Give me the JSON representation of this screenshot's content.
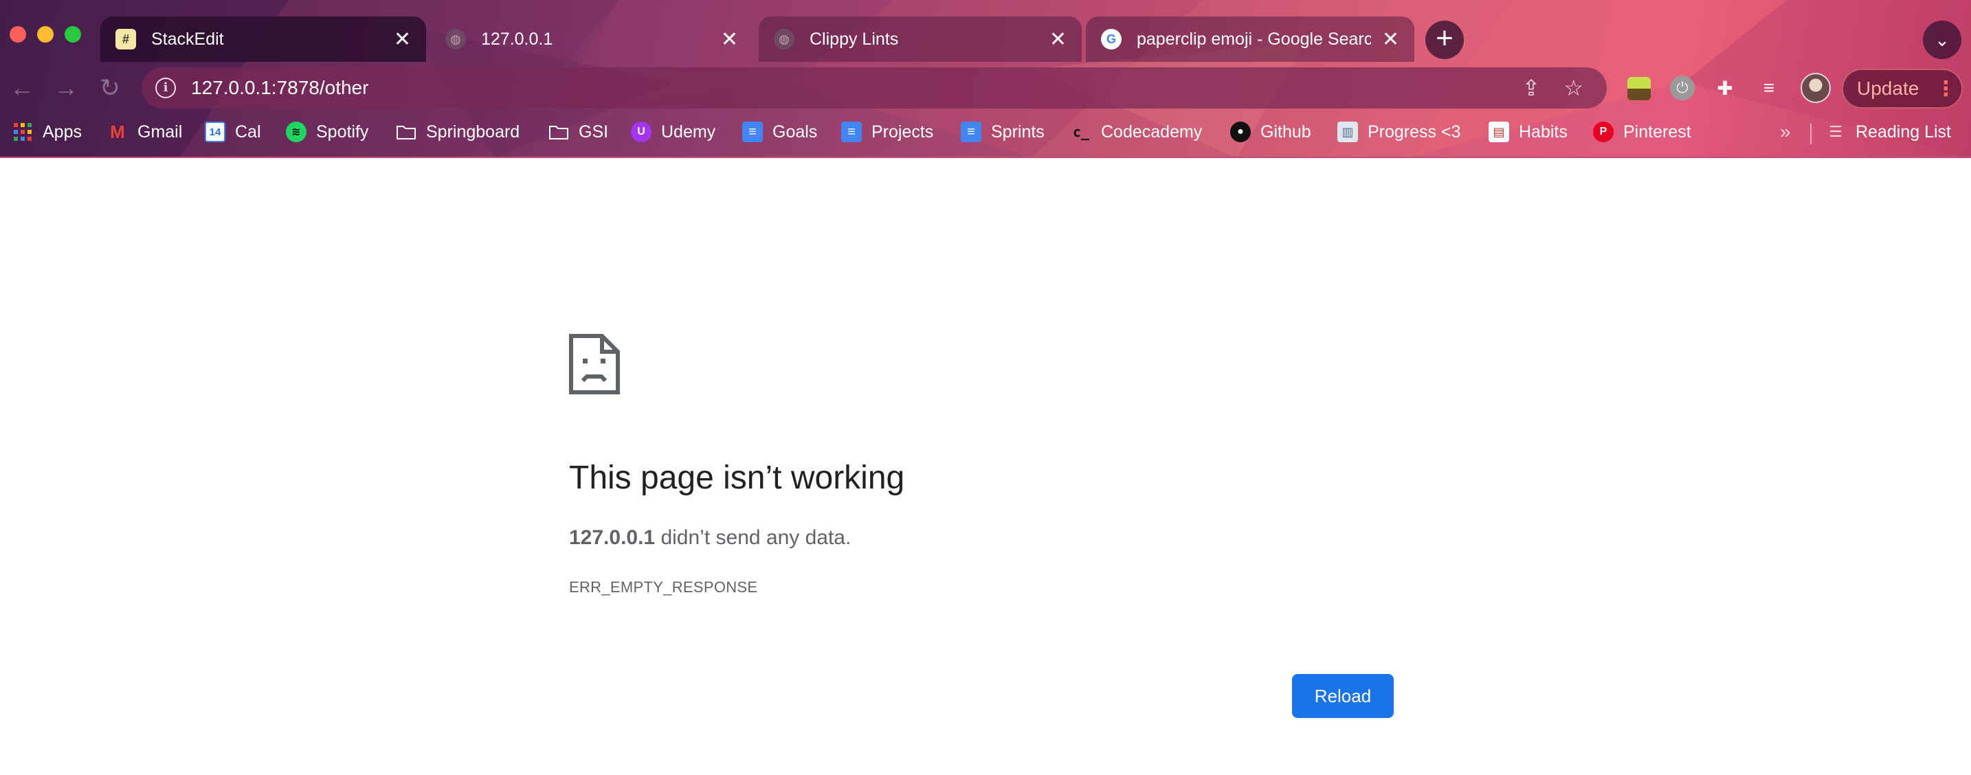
{
  "window": {
    "traffic_lights": [
      "close",
      "minimize",
      "maximize"
    ]
  },
  "tabs": [
    {
      "title": "StackEdit",
      "icon": "stackedit-icon",
      "active": true,
      "close": "✕"
    },
    {
      "title": "127.0.0.1",
      "icon": "globe-icon",
      "active": false,
      "close": "✕"
    },
    {
      "title": "Clippy Lints",
      "icon": "globe-icon",
      "active": false,
      "close": "✕"
    },
    {
      "title": "paperclip emoji - Google Searc",
      "icon": "google-icon",
      "active": false,
      "close": "✕"
    }
  ],
  "toolbar": {
    "url": "127.0.0.1:7878/other",
    "update_label": "Update"
  },
  "bookmarks": [
    {
      "label": "Apps",
      "icon": "apps-grid-icon"
    },
    {
      "label": "Gmail",
      "icon": "gmail-icon"
    },
    {
      "label": "Cal",
      "icon": "calendar-icon",
      "icon_text": "14"
    },
    {
      "label": "Spotify",
      "icon": "spotify-icon"
    },
    {
      "label": "Springboard",
      "icon": "folder-icon"
    },
    {
      "label": "GSI",
      "icon": "folder-icon"
    },
    {
      "label": "Udemy",
      "icon": "udemy-icon"
    },
    {
      "label": "Goals",
      "icon": "docs-icon"
    },
    {
      "label": "Projects",
      "icon": "docs-icon"
    },
    {
      "label": "Sprints",
      "icon": "docs-icon"
    },
    {
      "label": "Codecademy",
      "icon": "codecademy-icon"
    },
    {
      "label": "Github",
      "icon": "github-icon"
    },
    {
      "label": "Progress <3",
      "icon": "trello-icon"
    },
    {
      "label": "Habits",
      "icon": "habits-icon"
    },
    {
      "label": "Pinterest",
      "icon": "pinterest-icon"
    }
  ],
  "bookmarks_overflow": "»",
  "reading_list": "Reading List",
  "error": {
    "title": "This page isn’t working",
    "host": "127.0.0.1",
    "message": " didn’t send any data.",
    "code": "ERR_EMPTY_RESPONSE",
    "reload_label": "Reload"
  },
  "colors": {
    "reload_button": "#1a73e8",
    "title_text": "#202124",
    "body_text": "#5f6368"
  }
}
